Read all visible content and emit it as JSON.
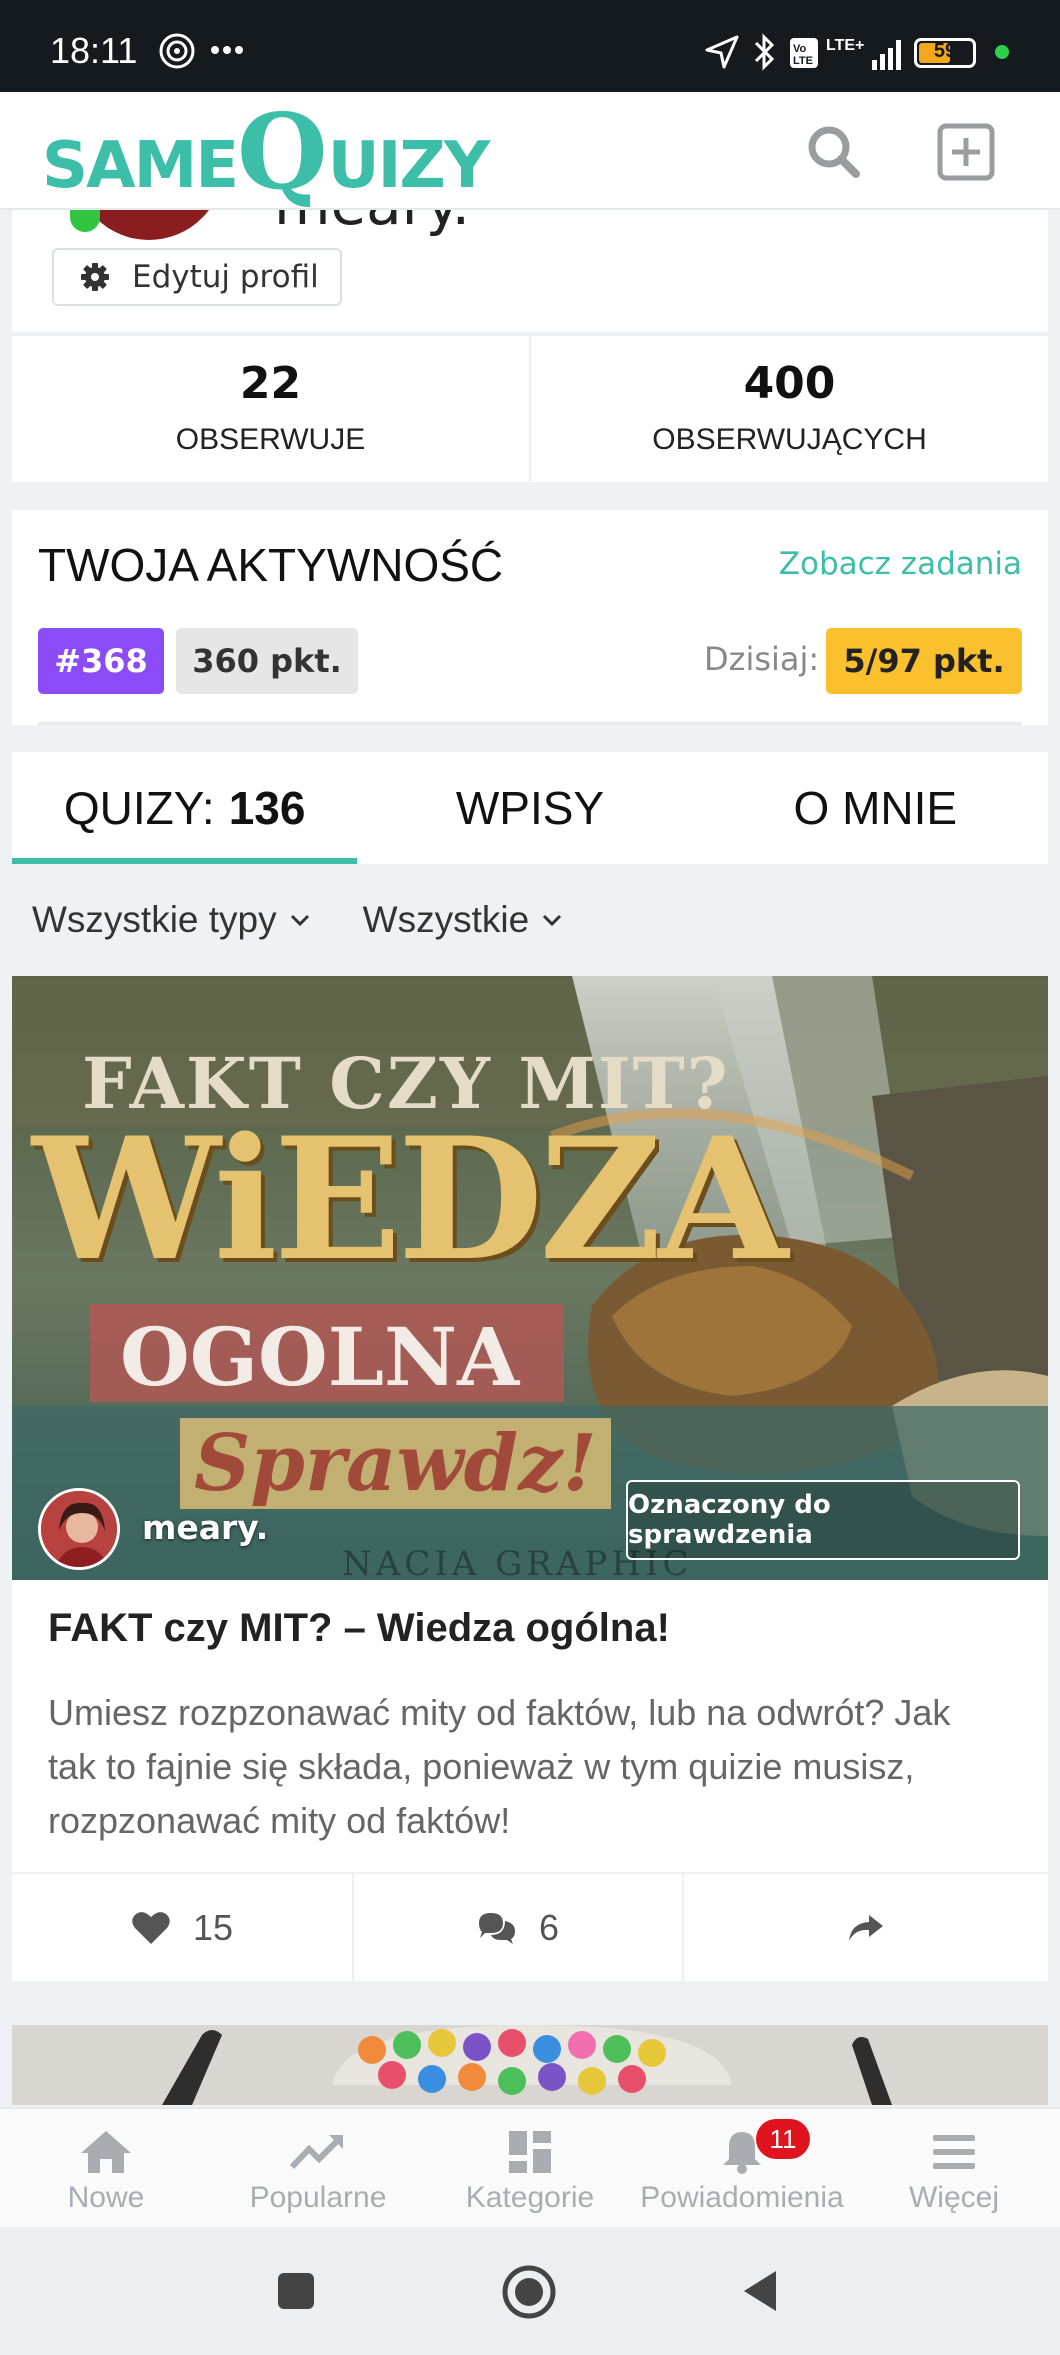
{
  "status_bar": {
    "time": "18:11",
    "battery": "59",
    "battery_level": 0.59,
    "network": "LTE+"
  },
  "header": {
    "logo": "SAMEQUIZY",
    "logo_parts": [
      "SAME",
      "Q",
      "UIZY"
    ],
    "search_icon": "search-icon",
    "add_icon": "plus-square-icon",
    "accent": "#3cbea9"
  },
  "profile": {
    "name": "meary.",
    "edit_label": "Edytuj profil"
  },
  "stats": {
    "following_count": "22",
    "following_label": "OBSERWUJE",
    "followers_count": "400",
    "followers_label": "OBSERWUJĄCYCH"
  },
  "activity": {
    "title": "TWOJA AKTYWNOŚĆ",
    "link": "Zobacz zadania",
    "rank": "#368",
    "points": "360 pkt.",
    "today_label": "Dzisiaj:",
    "today_points": "5/97 pkt.",
    "rank_color": "#8b4cf7",
    "today_color": "#fbc02d"
  },
  "tabs": [
    {
      "label": "QUIZY:",
      "count": "136",
      "active": true
    },
    {
      "label": "WPISY",
      "active": false
    },
    {
      "label": "O MNIE",
      "active": false
    }
  ],
  "filters": [
    {
      "label": "Wszystkie typy"
    },
    {
      "label": "Wszystkie"
    }
  ],
  "quiz": {
    "image_text": {
      "line1": "FAKT CZY MIT?",
      "line2": "WiEDZA",
      "line3": "OGOLNA",
      "line4": "Sprawdz!",
      "watermark": "NACIA GRAPHIC"
    },
    "author": "meary.",
    "status": "Oznaczony do sprawdzenia",
    "title": "FAKT czy MIT? – Wiedza ogólna!",
    "description": "Umiesz rozpzonawać mity od faktów, lub na odwrót? Jak tak to fajnie się składa, ponieważ w tym quizie musisz, rozpzonawać mity od faktów!",
    "likes": "15",
    "comments": "6"
  },
  "bottom_nav": [
    {
      "label": "Nowe",
      "icon": "home-icon"
    },
    {
      "label": "Popularne",
      "icon": "trending-icon"
    },
    {
      "label": "Kategorie",
      "icon": "grid-icon"
    },
    {
      "label": "Powiadomienia",
      "icon": "bell-icon",
      "badge": "11"
    },
    {
      "label": "Więcej",
      "icon": "menu-icon"
    }
  ]
}
